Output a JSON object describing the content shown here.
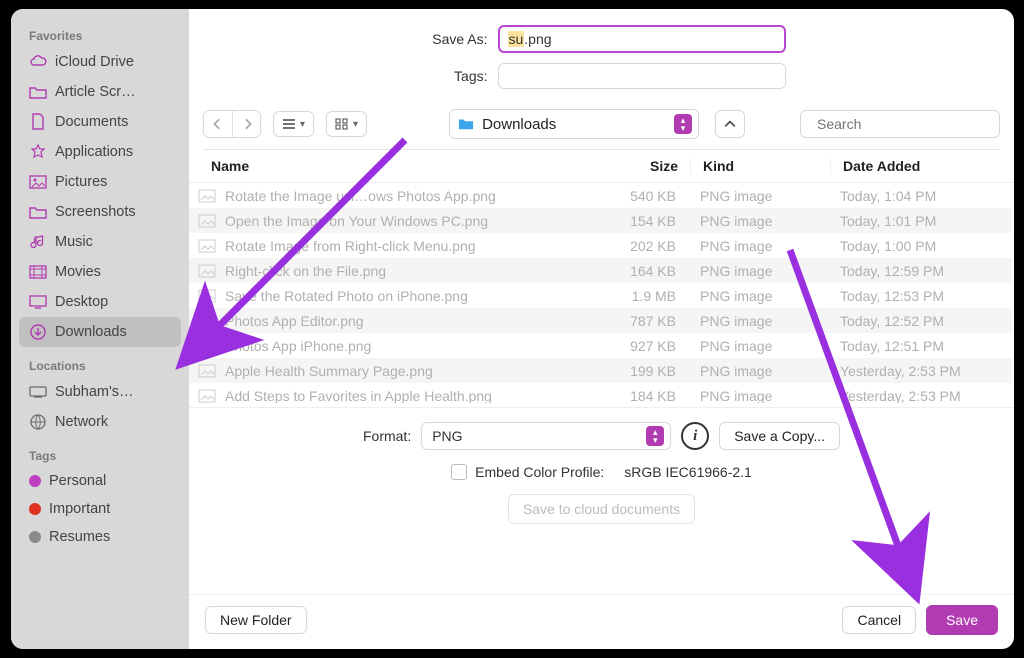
{
  "saveAs": {
    "label": "Save As:",
    "selected": "su",
    "suffix": ".png"
  },
  "tags": {
    "label": "Tags:"
  },
  "sidebar": {
    "favoritesLabel": "Favorites",
    "favorites": [
      {
        "name": "iCloud Drive"
      },
      {
        "name": "Article Scr…"
      },
      {
        "name": "Documents"
      },
      {
        "name": "Applications"
      },
      {
        "name": "Pictures"
      },
      {
        "name": "Screenshots"
      },
      {
        "name": "Music"
      },
      {
        "name": "Movies"
      },
      {
        "name": "Desktop"
      },
      {
        "name": "Downloads",
        "selected": true
      }
    ],
    "locationsLabel": "Locations",
    "locations": [
      {
        "name": "Subham's…"
      },
      {
        "name": "Network"
      }
    ],
    "tagsLabel": "Tags",
    "tags": [
      {
        "name": "Personal",
        "color": "#bf3fbf"
      },
      {
        "name": "Important",
        "color": "#e03020"
      },
      {
        "name": "Resumes",
        "color": "#8a8a8a"
      }
    ]
  },
  "path": {
    "folderName": "Downloads"
  },
  "search": {
    "placeholder": "Search"
  },
  "columns": {
    "name": "Name",
    "size": "Size",
    "kind": "Kind",
    "date": "Date Added"
  },
  "files": [
    {
      "name": "Rotate the Image usi…ows Photos App.png",
      "size": "540 KB",
      "kind": "PNG image",
      "date": "Today, 1:04 PM"
    },
    {
      "name": "Open the Image on Your Windows PC.png",
      "size": "154 KB",
      "kind": "PNG image",
      "date": "Today, 1:01 PM"
    },
    {
      "name": "Rotate Image from Right-click Menu.png",
      "size": "202 KB",
      "kind": "PNG image",
      "date": "Today, 1:00 PM"
    },
    {
      "name": "Right-click on the File.png",
      "size": "164 KB",
      "kind": "PNG image",
      "date": "Today, 12:59 PM"
    },
    {
      "name": "Save the Rotated Photo on iPhone.png",
      "size": "1.9 MB",
      "kind": "PNG image",
      "date": "Today, 12:53 PM"
    },
    {
      "name": "Photos App Editor.png",
      "size": "787 KB",
      "kind": "PNG image",
      "date": "Today, 12:52 PM"
    },
    {
      "name": "Photos App iPhone.png",
      "size": "927 KB",
      "kind": "PNG image",
      "date": "Today, 12:51 PM"
    },
    {
      "name": "Apple Health Summary Page.png",
      "size": "199 KB",
      "kind": "PNG image",
      "date": "Yesterday, 2:53 PM"
    },
    {
      "name": "Add Steps to Favorites in Apple Health.png",
      "size": "184 KB",
      "kind": "PNG image",
      "date": "Yesterday, 2:53 PM"
    }
  ],
  "format": {
    "label": "Format:",
    "value": "PNG"
  },
  "saveCopy": {
    "label": "Save a Copy..."
  },
  "embed": {
    "label": "Embed Color Profile:",
    "profile": "sRGB IEC61966-2.1"
  },
  "cloud": {
    "label": "Save to cloud documents"
  },
  "bottom": {
    "newFolder": "New Folder",
    "cancel": "Cancel",
    "save": "Save"
  }
}
